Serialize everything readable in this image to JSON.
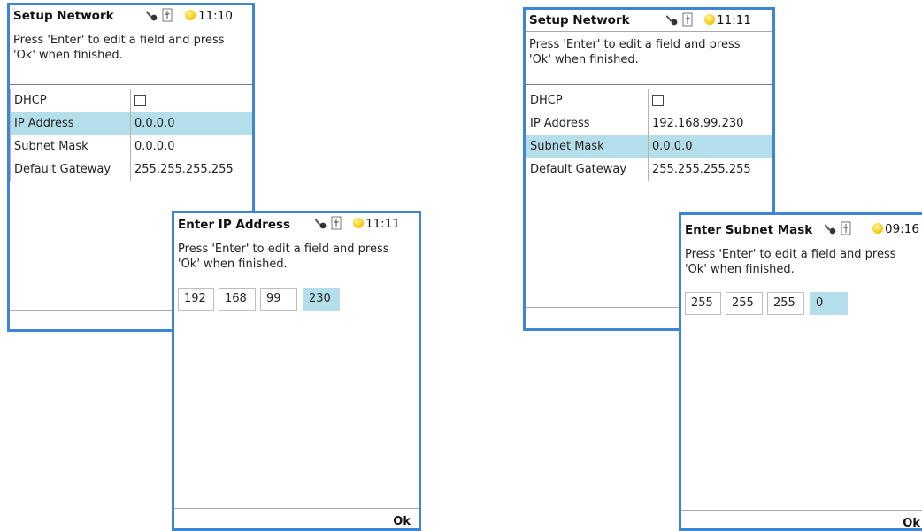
{
  "left": {
    "network": {
      "title": "Setup Network",
      "time": "11:10",
      "instruction_line1": "Press 'Enter' to edit a field and press",
      "instruction_line2": "'Ok' when finished.",
      "rows": [
        {
          "label": "DHCP",
          "value": ""
        },
        {
          "label": "IP Address",
          "value": "0.0.0.0"
        },
        {
          "label": "Subnet Mask",
          "value": "0.0.0.0"
        },
        {
          "label": "Default Gateway",
          "value": "255.255.255.255"
        }
      ],
      "dhcp_checked": false,
      "selected_row": "IP Address"
    },
    "dialog": {
      "title": "Enter IP Address",
      "time": "11:11",
      "instruction_line1": "Press 'Enter' to edit a field and press",
      "instruction_line2": "'Ok' when finished.",
      "octets": [
        "192",
        "168",
        "99",
        "230"
      ],
      "selected_octet": 4,
      "ok_label": "Ok"
    }
  },
  "right": {
    "network": {
      "title": "Setup Network",
      "time": "11:11",
      "instruction_line1": "Press 'Enter' to edit a field and press",
      "instruction_line2": "'Ok' when finished.",
      "rows": [
        {
          "label": "DHCP",
          "value": ""
        },
        {
          "label": "IP Address",
          "value": "192.168.99.230"
        },
        {
          "label": "Subnet Mask",
          "value": "0.0.0.0"
        },
        {
          "label": "Default Gateway",
          "value": "255.255.255.255"
        }
      ],
      "dhcp_checked": false,
      "selected_row": "Subnet Mask"
    },
    "dialog": {
      "title": "Enter Subnet Mask",
      "time": "09:16",
      "instruction_line1": "Press 'Enter' to edit a field and press",
      "instruction_line2": "'Ok' when finished.",
      "octets": [
        "255",
        "255",
        "255",
        "0"
      ],
      "selected_octet": 4,
      "ok_label": "Ok"
    }
  },
  "icons": {
    "status": [
      "key-icon",
      "usb-icon",
      "sun-icon"
    ]
  },
  "colors": {
    "frame_border": "#3e86d3",
    "selection": "#b4dfea",
    "sun": "#f5c400"
  }
}
